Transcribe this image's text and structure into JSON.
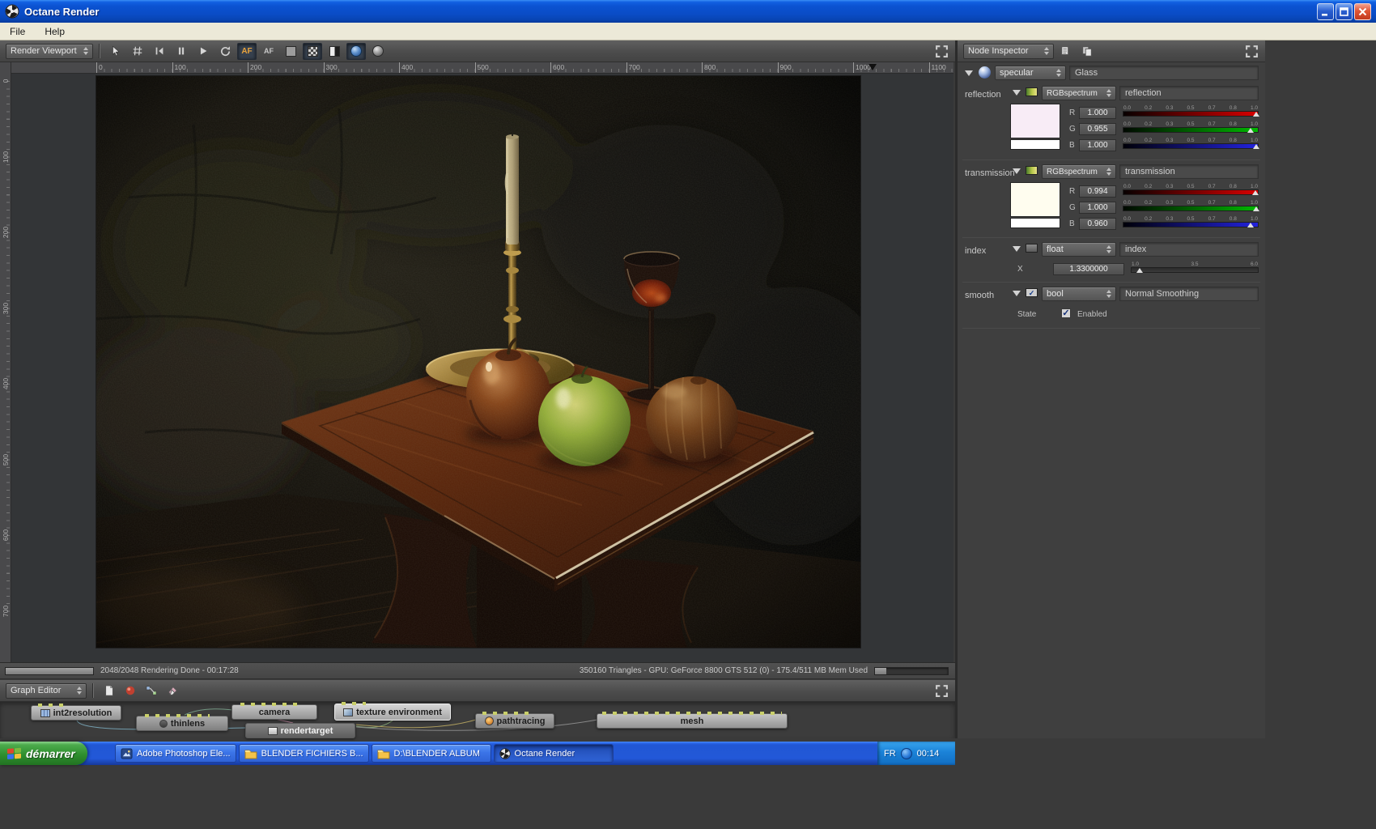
{
  "window": {
    "title": "Octane Render",
    "menu": {
      "file": "File",
      "help": "Help"
    }
  },
  "viewport": {
    "combo_label": "Render Viewport",
    "af_label": "AF",
    "toolbar_icons": [
      "select-arrow-icon",
      "grid-icon",
      "rewind-icon",
      "pause-icon",
      "play-icon",
      "refresh-icon",
      "af-lock-icon",
      "af-once-icon",
      "solid-square-icon",
      "checkerboard-icon",
      "contrast-square-icon",
      "globe-icon",
      "sphere-icon",
      "expand-icon"
    ],
    "ruler_h": [
      "0",
      "100",
      "200",
      "300",
      "400",
      "500",
      "600",
      "700",
      "800",
      "900",
      "1000",
      "1100"
    ],
    "ruler_v": [
      "0",
      "100",
      "200",
      "300",
      "400",
      "500",
      "600",
      "700"
    ],
    "status_left": "2048/2048 Rendering Done - 00:17:28",
    "status_right": "350160 Triangles - GPU: GeForce 8800 GTS 512 (0) - 175.4/511 MB Mem Used"
  },
  "inspector": {
    "combo_label": "Node Inspector",
    "node": {
      "kind": "specular",
      "name": "Glass"
    },
    "rgb_ticks": [
      "0.0",
      "0.2",
      "0.3",
      "0.5",
      "0.7",
      "0.8",
      "1.0"
    ],
    "reflection": {
      "section_label": "reflection",
      "type": "RGBspectrum",
      "name": "reflection",
      "swatch_color": "#f8ecf6",
      "rows": [
        {
          "ch": "R",
          "value": "1.000"
        },
        {
          "ch": "G",
          "value": "0.955"
        },
        {
          "ch": "B",
          "value": "1.000"
        }
      ]
    },
    "transmission": {
      "section_label": "transmission",
      "type": "RGBspectrum",
      "name": "transmission",
      "swatch_color": "#fffdef",
      "rows": [
        {
          "ch": "R",
          "value": "0.994"
        },
        {
          "ch": "G",
          "value": "1.000"
        },
        {
          "ch": "B",
          "value": "0.960"
        }
      ]
    },
    "index": {
      "section_label": "index",
      "type": "float",
      "name": "index",
      "axis_label": "X",
      "value": "1.3300000",
      "ticks": [
        "1.0",
        "3.5",
        "6.0"
      ]
    },
    "smooth": {
      "section_label": "smooth",
      "type": "bool",
      "name": "Normal Smoothing",
      "state_label": "State",
      "state_value": "Enabled",
      "checked": true
    }
  },
  "graph": {
    "combo_label": "Graph Editor",
    "nodes": [
      {
        "label": "int2resolution"
      },
      {
        "label": "thinlens"
      },
      {
        "label": "camera"
      },
      {
        "label": "texture environment"
      },
      {
        "label": "rendertarget"
      },
      {
        "label": "pathtracing"
      },
      {
        "label": "mesh"
      }
    ]
  },
  "taskbar": {
    "start_label": "démarrer",
    "buttons": [
      {
        "label": "Adobe Photoshop Ele...",
        "icon": "photoshop-icon"
      },
      {
        "label": "BLENDER FICHIERS B...",
        "icon": "folder-icon"
      },
      {
        "label": "D:\\BLENDER ALBUM",
        "icon": "folder-icon"
      },
      {
        "label": "Octane Render",
        "icon": "octane-icon"
      }
    ],
    "tray": {
      "lang": "FR",
      "time": "00:14"
    }
  },
  "colors": {
    "titlebar_blue": "#0a4cc6",
    "taskbar_blue": "#2157d4",
    "start_green": "#2f8f2f",
    "pressed_button_blue": "#36404e",
    "slider_red": "#d80000",
    "slider_green": "#00b800",
    "slider_blue": "#2222dd",
    "reflection_swatch": "#f8ecf6",
    "transmission_swatch": "#fffdef"
  }
}
